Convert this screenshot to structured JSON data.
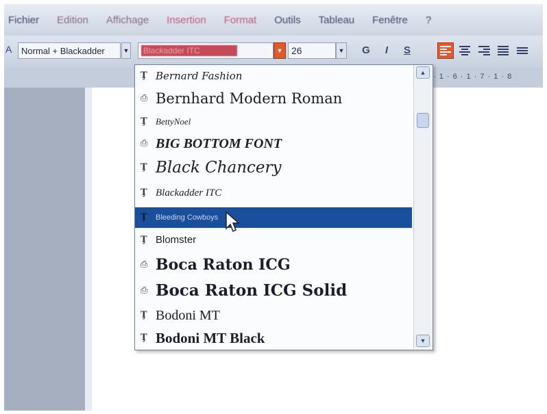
{
  "menubar": {
    "items": [
      "Fichier",
      "Edition",
      "Affichage",
      "Insertion",
      "Format",
      "Outils",
      "Tableau",
      "Fenêtre",
      "?"
    ]
  },
  "toolbar": {
    "style_value": "Normal + Blackadder",
    "font_value": "Blackadder ITC",
    "size_value": "26",
    "bold_label": "G",
    "italic_label": "I",
    "underline_label": "S"
  },
  "ruler": {
    "marks": "· 1 · 6 · 1 · 7 · 1 · 8"
  },
  "font_list": {
    "items": [
      {
        "name": "Bernard Fashion",
        "icon": "T",
        "font": "DejaVu Serif",
        "style": "italic",
        "size": "15px",
        "weight": "normal",
        "selected": false
      },
      {
        "name": "Bernhard Modern Roman",
        "icon": "printer",
        "font": "DejaVu Serif",
        "style": "normal",
        "size": "21px",
        "weight": "normal",
        "selected": false
      },
      {
        "name": "BettyNoel",
        "icon": "T",
        "font": "Liberation Serif",
        "style": "italic",
        "size": "13px",
        "weight": "normal",
        "selected": false
      },
      {
        "name": "BIG BOTTOM FONT",
        "icon": "printer",
        "font": "Liberation Serif",
        "style": "italic",
        "size": "20px",
        "weight": "bold",
        "selected": false
      },
      {
        "name": "Black Chancery",
        "icon": "T",
        "font": "DejaVu Serif",
        "style": "italic",
        "size": "23px",
        "weight": "normal",
        "selected": false
      },
      {
        "name": "Blackadder ITC",
        "icon": "T",
        "font": "Liberation Serif",
        "style": "italic",
        "size": "15px",
        "weight": "normal",
        "selected": false
      },
      {
        "name": "Bleeding Cowboys",
        "icon": "T",
        "font": "Liberation Sans",
        "style": "normal",
        "size": "11px",
        "weight": "normal",
        "selected": true
      },
      {
        "name": "Blomster",
        "icon": "T",
        "font": "Liberation Sans",
        "style": "normal",
        "size": "15px",
        "weight": "normal",
        "selected": false
      },
      {
        "name": "Boca Raton ICG",
        "icon": "printer",
        "font": "DejaVu Serif",
        "style": "normal",
        "size": "22px",
        "weight": "bold",
        "selected": false
      },
      {
        "name": "Boca Raton ICG Solid",
        "icon": "printer",
        "font": "DejaVu Serif",
        "style": "normal",
        "size": "23px",
        "weight": "bold",
        "selected": false
      },
      {
        "name": "Bodoni MT",
        "icon": "T",
        "font": "Liberation Serif",
        "style": "normal",
        "size": "20px",
        "weight": "normal",
        "selected": false
      },
      {
        "name": "Bodoni MT Black",
        "icon": "T",
        "font": "Liberation Serif",
        "style": "normal",
        "size": "21px",
        "weight": "bold",
        "selected": false
      }
    ]
  },
  "colors": {
    "selection": "#1a4f9d",
    "accent_orange": "#e35a2e",
    "font_box_highlight": "#c44a5a"
  }
}
